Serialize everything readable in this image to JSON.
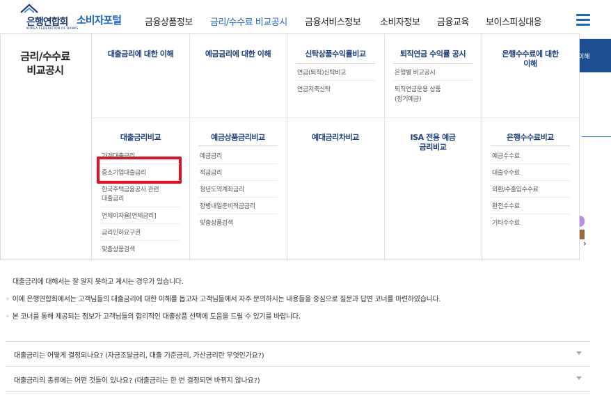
{
  "header": {
    "logo_text": "은행연합회",
    "logo_sub": "KOREA FEDERATION OF BANKS",
    "portal": "소비자포털",
    "nav": [
      "금융상품정보",
      "금리/수수료 비교공시",
      "금융서비스정보",
      "소비자정보",
      "금융교육",
      "보이스피싱대응"
    ],
    "active_nav": "금리/수수료 비교공시",
    "menu_icon": "hamburger-menu-icon"
  },
  "mega_menu": {
    "title_line1": "금리/수수료",
    "title_line2": "비교공시",
    "top_row": [
      {
        "head": "대출금리에 대한 이해",
        "items": []
      },
      {
        "head": "예금금리에 대한 이해",
        "items": []
      },
      {
        "head": "신탁상품수익률비교",
        "items": [
          "연금(퇴직)신탁비교",
          "연금저축신탁"
        ]
      },
      {
        "head": "퇴직연금 수익률 공시",
        "items": [
          "은행별 비교공시",
          "퇴직연금운용 상품",
          "(정기예금)"
        ]
      },
      {
        "head_line1": "은행수수료에 대한",
        "head_line2": "이해",
        "items": []
      }
    ],
    "bottom_row": [
      {
        "head": "대출금리비교",
        "items": [
          "가계대출금리",
          "중소기업대출금리",
          "한국주택금융공사 관련",
          "대출금리",
          "연체이자율[연체금리]",
          "금리인하요구권",
          "맞춤상품검색"
        ]
      },
      {
        "head": "예금상품금리비교",
        "items": [
          "예금금리",
          "적금금리",
          "청년도약계좌금리",
          "장병내일준비적금금리",
          "맞춤상품검색"
        ]
      },
      {
        "head": "예대금리차비교",
        "items": []
      },
      {
        "head_line1": "ISA 전용 예금",
        "head_line2": "금리비교",
        "items": []
      },
      {
        "head": "은행수수료비교",
        "items": [
          "예금수수료",
          "대출수수료",
          "외환/수출입수수료",
          "환전수수료",
          "기타수수료"
        ]
      }
    ],
    "highlighted": "대출금리비교"
  },
  "page": {
    "right_band_text": "이해",
    "para_line0": "대출금리에 대해서는 잘 알지 못하고 계시는 경우가 있습니다.",
    "para_line1": "이에 은행연합회에서는 고객님들의 대출금리에 대한 이해를 돕고자 고객님들께서 자주 문의하시는 내용들을 중심으로 질문과 답변 코너를 마련하였습니다.",
    "para_line2": "본 코너를 통해 제공되는 정보가 고객님들의 합리적인 대출상품 선택에 도움을 드릴 수 있기를 바랍니다.",
    "faq": [
      "대출금리는 어떻게 결정되나요? (자금조달금리, 대출 기준금리, 가산금리란 무엇인가요?)",
      "대출금리의 종류에는 어떤 것들이 있나요? (대출금리는 한 번 결정되면 바뀌지 않나요?)"
    ]
  },
  "colors": {
    "brand_blue": "#1e64c8",
    "navy": "#1a3f78",
    "highlight_red": "#e6101f"
  }
}
